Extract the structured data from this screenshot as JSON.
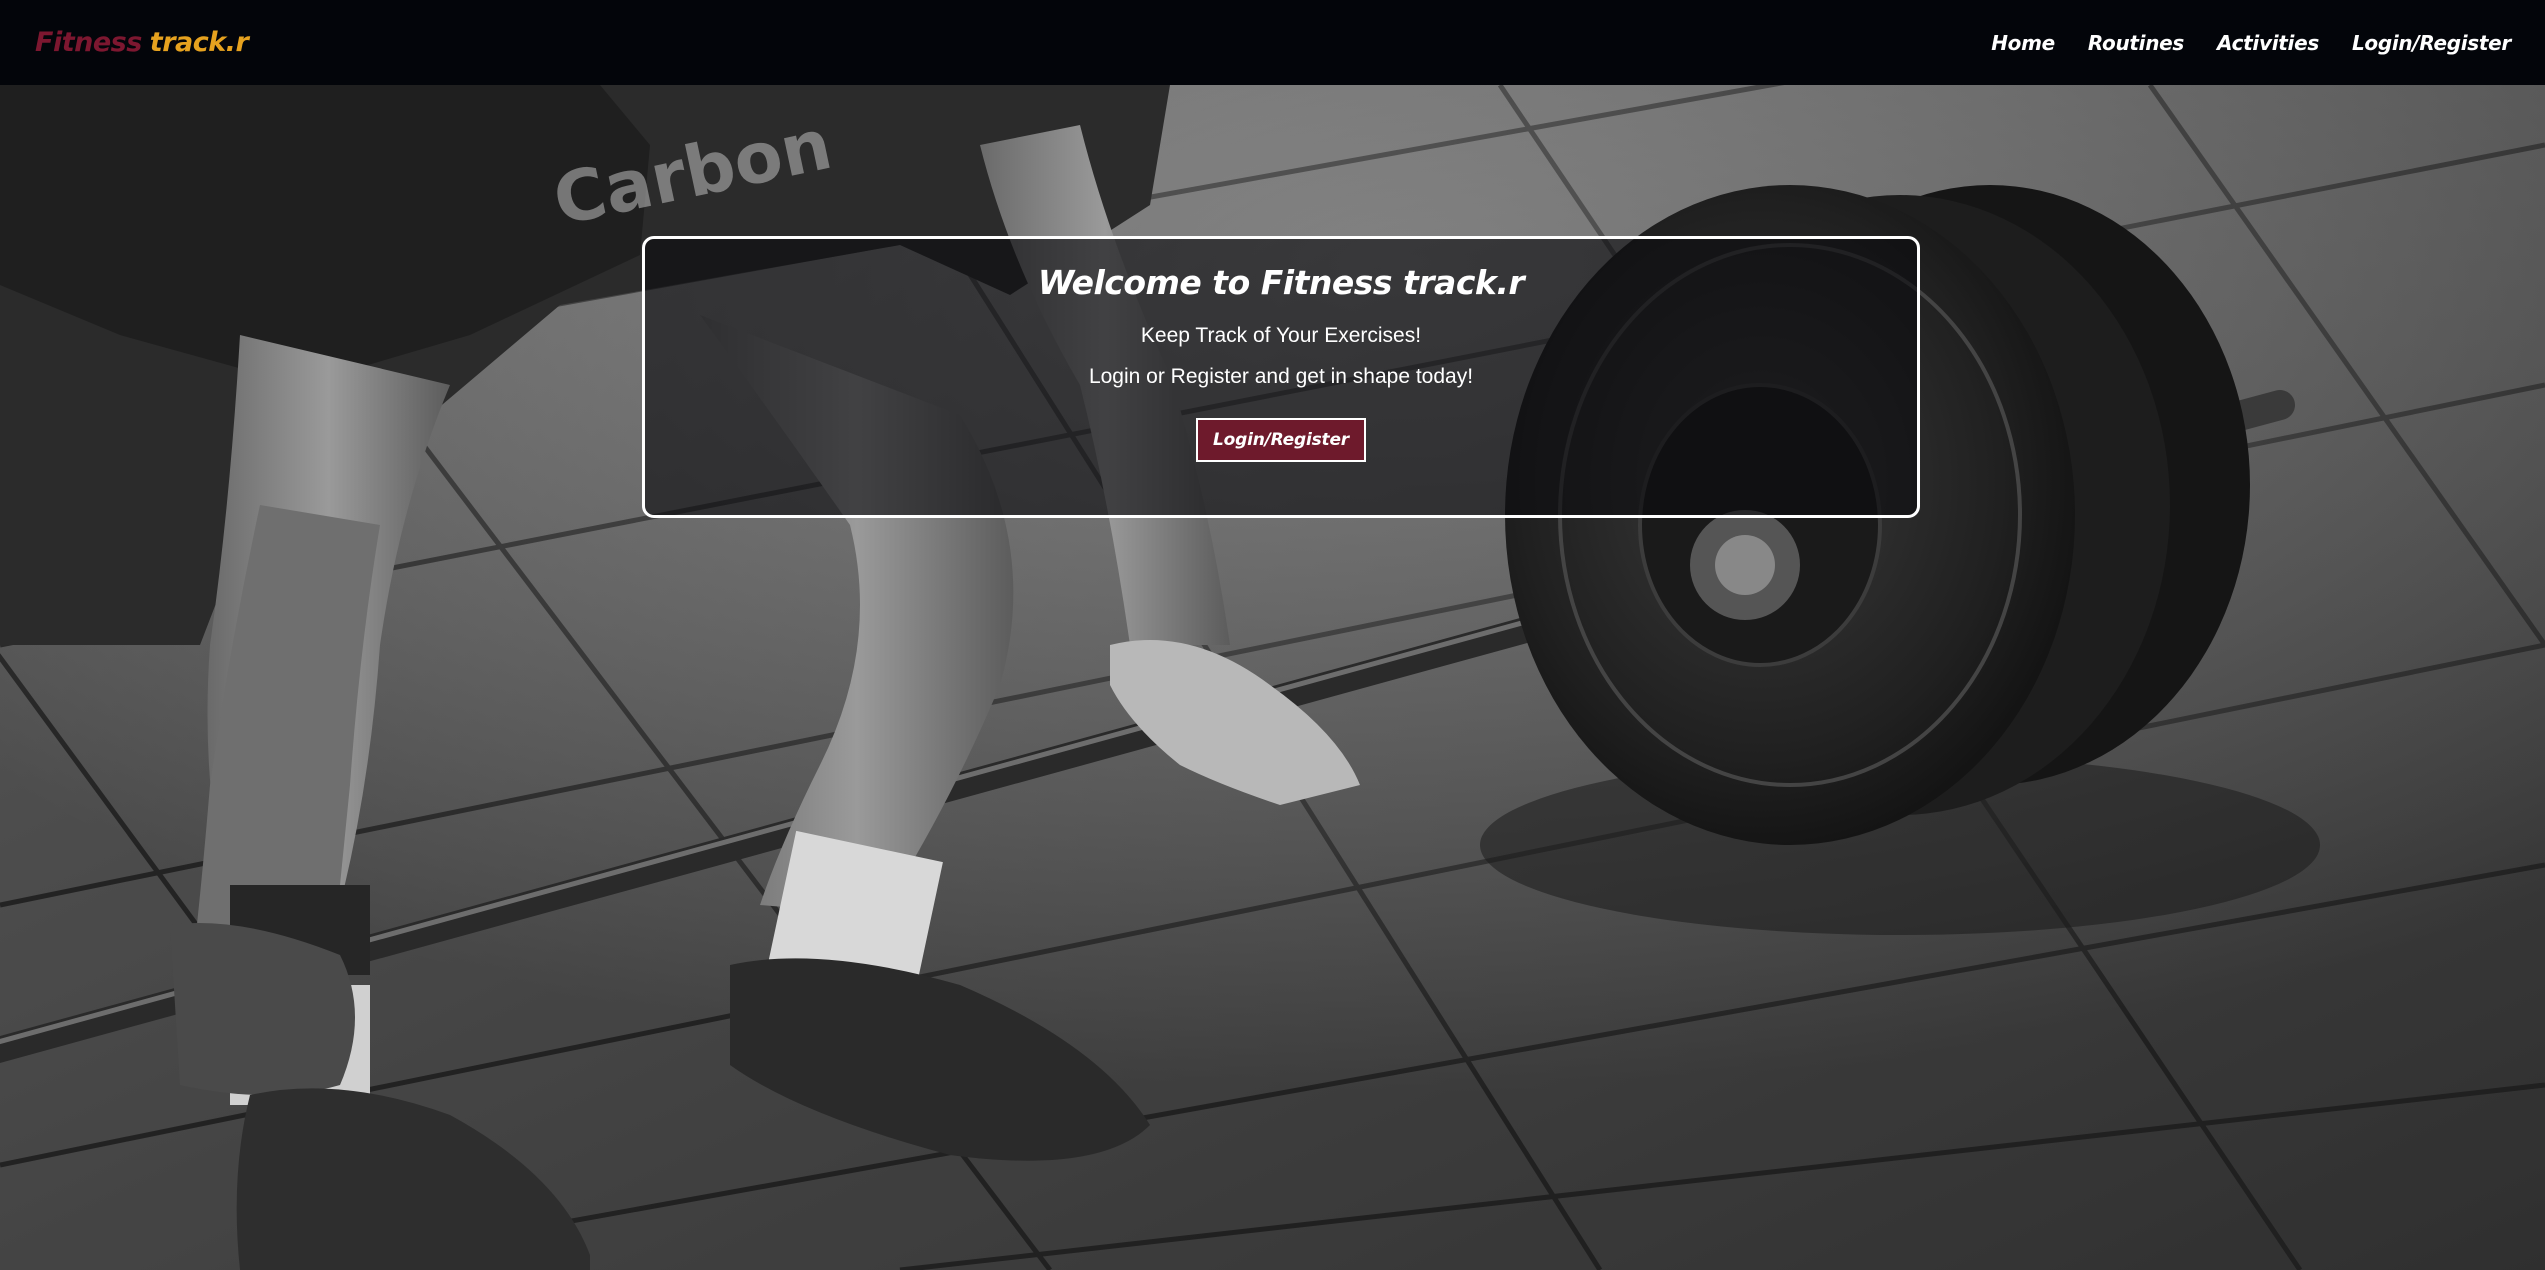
{
  "brand": {
    "part1": "Fitness",
    "part2": "track.r",
    "color1": "#7d1730",
    "color2": "#e6a21f"
  },
  "nav": {
    "items": [
      {
        "label": "Home"
      },
      {
        "label": "Routines"
      },
      {
        "label": "Activities"
      },
      {
        "label": "Login/Register"
      }
    ]
  },
  "hero": {
    "image": "grayscale-gym-deadlift-photo",
    "title": "Welcome to Fitness track.r",
    "subtitle": "Keep Track of Your Exercises!",
    "subtitle2": "Login or Register and get in shape today!",
    "cta_label": "Login/Register",
    "cta_color": "#6e1a2c"
  }
}
